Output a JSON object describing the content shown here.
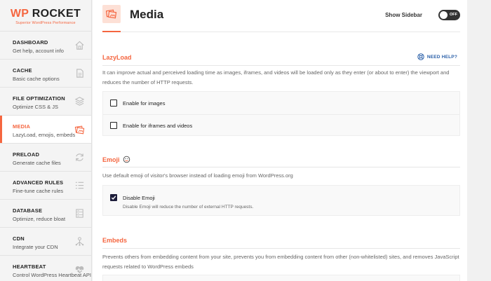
{
  "brand": {
    "name_part1": "WP",
    "name_part2": " ROCKET",
    "tagline": "Superior WordPress Performance"
  },
  "sidebar": {
    "items": [
      {
        "title": "DASHBOARD",
        "subtitle": "Get help, account info",
        "icon": "home-icon",
        "active": false
      },
      {
        "title": "CACHE",
        "subtitle": "Basic cache options",
        "icon": "file-icon",
        "active": false
      },
      {
        "title": "FILE OPTIMIZATION",
        "subtitle": "Optimize CSS & JS",
        "icon": "layers-icon",
        "active": false
      },
      {
        "title": "MEDIA",
        "subtitle": "LazyLoad, emojis, embeds",
        "icon": "image-icon",
        "active": true
      },
      {
        "title": "PRELOAD",
        "subtitle": "Generate cache files",
        "icon": "refresh-icon",
        "active": false
      },
      {
        "title": "ADVANCED RULES",
        "subtitle": "Fine-tune cache rules",
        "icon": "list-icon",
        "active": false
      },
      {
        "title": "DATABASE",
        "subtitle": "Optimize, reduce bloat",
        "icon": "database-icon",
        "active": false
      },
      {
        "title": "CDN",
        "subtitle": "Integrate your CDN",
        "icon": "cdn-icon",
        "active": false
      },
      {
        "title": "HEARTBEAT",
        "subtitle": "Control WordPress Heartbeat API",
        "icon": "heartbeat-icon",
        "active": false
      }
    ]
  },
  "header": {
    "title": "Media",
    "show_sidebar_label": "Show Sidebar",
    "toggle_label": "OFF",
    "toggle_on": false
  },
  "lazyload": {
    "title": "LazyLoad",
    "need_help": "NEED HELP?",
    "description": "It can improve actual and perceived loading time as images, iframes, and videos will be loaded only as they enter (or about to enter) the viewport and reduces the number of HTTP requests.",
    "options": [
      {
        "label": "Enable for images",
        "checked": false
      },
      {
        "label": "Enable for iframes and videos",
        "checked": false
      }
    ]
  },
  "emoji": {
    "title": "Emoji",
    "description": "Use default emoji of visitor's browser instead of loading emoji from WordPress.org",
    "option": {
      "label": "Disable Emoji",
      "sublabel": "Disable Emoji will reduce the number of external HTTP requests.",
      "checked": true
    }
  },
  "embeds": {
    "title": "Embeds",
    "description": "Prevents others from embedding content from your site, prevents you from embedding content from other (non-whitelisted) sites, and removes JavaScript requests related to WordPress embeds"
  },
  "colors": {
    "accent": "#f56640",
    "link": "#2a5fa8",
    "checked": "#1d1d3a"
  }
}
